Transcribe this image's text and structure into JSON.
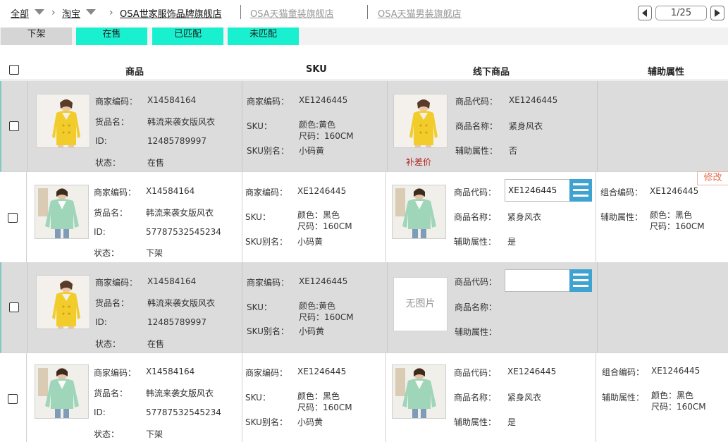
{
  "breadcrumb": {
    "all_label": "全部",
    "platform_label": "淘宝",
    "stores": [
      {
        "label": "OSA世家服饰品牌旗舰店",
        "active": true
      },
      {
        "label": "OSA天猫童装旗舰店",
        "active": false
      },
      {
        "label": "OSA天猫男装旗舰店",
        "active": false
      }
    ]
  },
  "pager": {
    "text": "1/25"
  },
  "filters": [
    {
      "label": "下架",
      "style": "gray"
    },
    {
      "label": "在售",
      "style": "teal"
    },
    {
      "label": "已匹配",
      "style": "teal"
    },
    {
      "label": "未匹配",
      "style": "teal"
    }
  ],
  "table": {
    "headers": {
      "product": "商品",
      "sku": "SKU",
      "offline": "线下商品",
      "aux": "辅助属性"
    },
    "labels": {
      "merchant_code": "商家编码：",
      "goods_name": "货品名：",
      "id": "ID:",
      "status": "状态：",
      "sku_merchant_code": "商家编码：",
      "sku": "SKU：",
      "sku_alias": "SKU别名：",
      "product_code": "商品代码：",
      "product_name": "商品名称：",
      "aux_attr": "辅助属性：",
      "combo_code": "组合编码：",
      "aux_attr2": "辅助属性："
    },
    "rows": [
      {
        "image": "yellow-coat",
        "merchant_code": "X14584164",
        "goods_name": "韩流来袭女版风衣",
        "id": "12485789997",
        "status": "在售",
        "sku_merchant_code": "XE1246445",
        "sku_line1": "颜色:黄色",
        "sku_line2": "尺码：160CM",
        "sku_alias": "小码黄",
        "offline_image": "yellow-coat",
        "price_diff": "补差价",
        "product_code": "XE1246445",
        "product_name": "紧身风衣",
        "aux_attr": "否"
      },
      {
        "image": "mint-coat",
        "merchant_code": "X14584164",
        "goods_name": "韩流来袭女版风衣",
        "id": "57787532545234",
        "status": "下架",
        "sku_merchant_code": "XE1246445",
        "sku_line1": "颜色：黑色",
        "sku_line2": "尺码：160CM",
        "sku_alias": "小码黄",
        "offline_image": "mint-coat",
        "product_code_input": "XE1246445",
        "product_name": "紧身风衣",
        "aux_attr": "是",
        "combo_code": "XE1246445",
        "aux_line1": "颜色：黑色",
        "aux_line2": "尺码：160CM",
        "edit_label": "修改"
      },
      {
        "image": "yellow-coat",
        "merchant_code": "X14584164",
        "goods_name": "韩流来袭女版风衣",
        "id": "12485789997",
        "status": "在售",
        "sku_merchant_code": "XE1246445",
        "sku_line1": "颜色:黄色",
        "sku_line2": "尺码：160CM",
        "sku_alias": "小码黄",
        "no_image_text": "无图片",
        "product_code_input": ""
      },
      {
        "image": "mint-coat",
        "merchant_code": "X14584164",
        "goods_name": "韩流来袭女版风衣",
        "id": "57787532545234",
        "status": "下架",
        "sku_merchant_code": "XE1246445",
        "sku_line1": "颜色：黑色",
        "sku_line2": "尺码：160CM",
        "sku_alias": "小码黄",
        "offline_image": "mint-coat",
        "product_code": "XE1246445",
        "product_name": "紧身风衣",
        "aux_attr": "是",
        "combo_code": "XE1246445",
        "aux_line1": "颜色：黑色",
        "aux_line2": "尺码：160CM"
      }
    ]
  },
  "colors": {
    "teal": "#19f0cf",
    "accent_blue": "#3ea3d1",
    "price_red": "#b0241f",
    "edit_orange": "#e0734f"
  }
}
